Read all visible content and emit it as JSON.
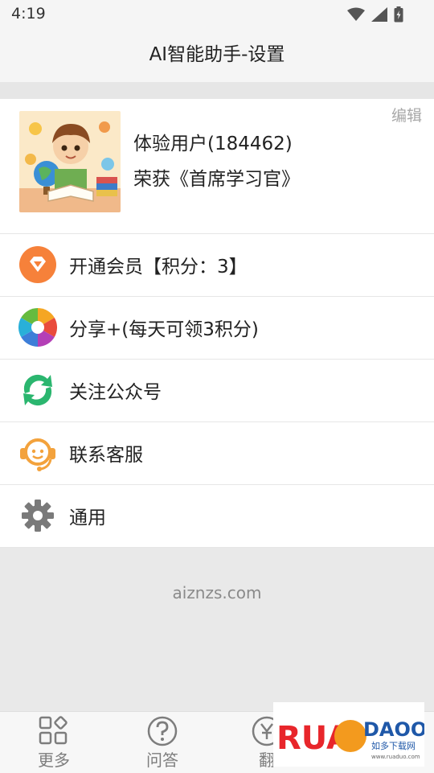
{
  "status_bar": {
    "time": "4:19"
  },
  "header": {
    "title": "AI智能助手-设置"
  },
  "profile": {
    "edit_label": "编辑",
    "name": "体验用户(184462)",
    "title": "荣获《首席学习官》"
  },
  "menu": {
    "items": [
      {
        "label": "开通会员【积分：3】",
        "icon": "diamond-icon"
      },
      {
        "label": "分享+(每天可领3积分)",
        "icon": "share-aperture-icon"
      },
      {
        "label": "关注公众号",
        "icon": "follow-recycle-icon"
      },
      {
        "label": "联系客服",
        "icon": "customer-service-icon"
      },
      {
        "label": "通用",
        "icon": "gear-icon"
      }
    ]
  },
  "footer": {
    "domain": "aiznzs.com"
  },
  "bottom_nav": {
    "items": [
      {
        "label": "更多",
        "icon": "grid-icon"
      },
      {
        "label": "问答",
        "icon": "question-icon"
      },
      {
        "label": "翻",
        "icon": "translate-icon"
      }
    ]
  },
  "watermark": {
    "brand": "RUANDAOO",
    "tagline": "如多下载网",
    "url": "www.ruaduo.com"
  },
  "colors": {
    "accent_orange": "#f6813a",
    "service_orange": "#f3a23c",
    "wechat_green": "#2bb66f"
  }
}
